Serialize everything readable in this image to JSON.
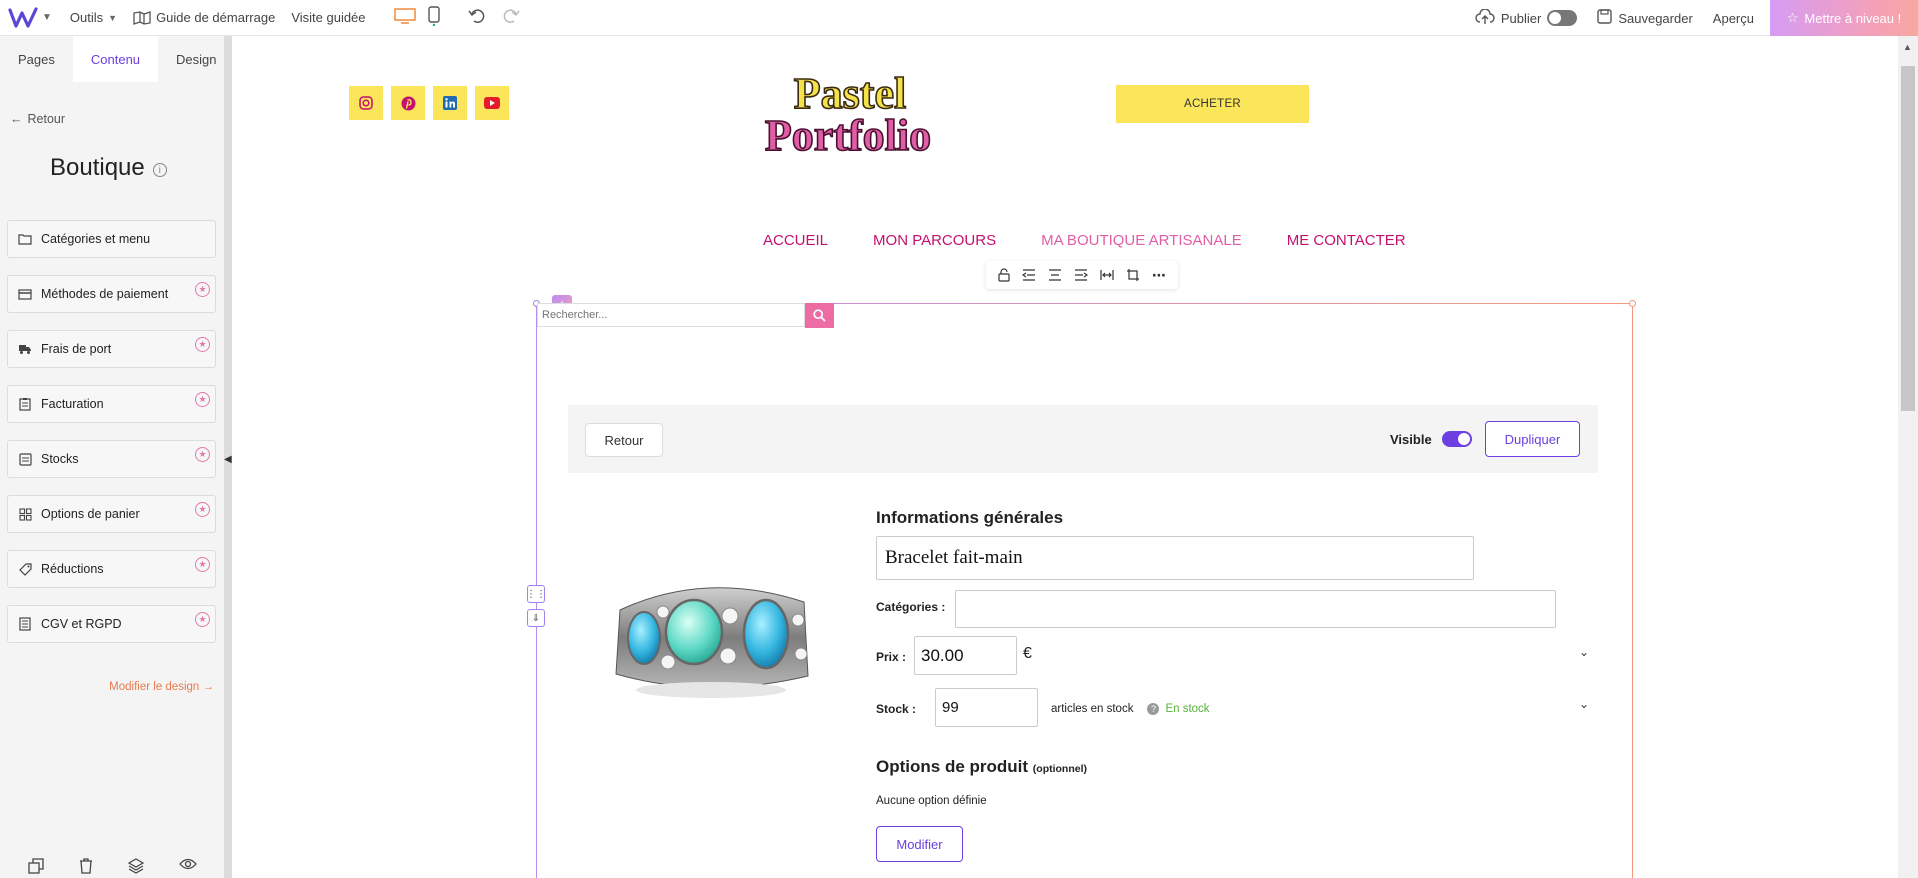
{
  "topbar": {
    "tools": "Outils",
    "start_guide": "Guide de démarrage",
    "guided_tour": "Visite guidée",
    "publish": "Publier",
    "save": "Sauvegarder",
    "preview": "Aperçu",
    "upgrade": "Mettre à niveau !"
  },
  "sidebar": {
    "tabs": [
      "Pages",
      "Contenu",
      "Design"
    ],
    "active_tab": "Contenu",
    "back": "Retour",
    "title": "Boutique",
    "items": [
      {
        "label": "Catégories et menu",
        "icon": "folder-icon",
        "premium": false
      },
      {
        "label": "Méthodes de paiement",
        "icon": "credit-card-icon",
        "premium": true
      },
      {
        "label": "Frais de port",
        "icon": "truck-icon",
        "premium": true
      },
      {
        "label": "Facturation",
        "icon": "clipboard-icon",
        "premium": true
      },
      {
        "label": "Stocks",
        "icon": "box-icon",
        "premium": true
      },
      {
        "label": "Options de panier",
        "icon": "grid-icon",
        "premium": true
      },
      {
        "label": "Réductions",
        "icon": "tag-icon",
        "premium": true
      },
      {
        "label": "CGV et RGPD",
        "icon": "document-icon",
        "premium": true
      }
    ],
    "modify_design": "Modifier le design →"
  },
  "site": {
    "socials": [
      "instagram-icon",
      "pinterest-icon",
      "linkedin-icon",
      "youtube-icon"
    ],
    "brand_line1": "Pastel",
    "brand_line2": "Portfolio",
    "buy": "ACHETER",
    "nav": [
      "ACCUEIL",
      "MON PARCOURS",
      "MA BOUTIQUE ARTISANALE",
      "ME CONTACTER"
    ],
    "search_placeholder": "Rechercher..."
  },
  "product_editor": {
    "back": "Retour",
    "visible": "Visible",
    "duplicate": "Dupliquer",
    "general_info": "Informations générales",
    "name": "Bracelet fait-main",
    "categories_label": "Catégories :",
    "price_label": "Prix :",
    "price": "30.00",
    "currency": "€",
    "stock_label": "Stock :",
    "stock": "99",
    "stock_unit": "articles en stock",
    "stock_status": "En stock",
    "options_title": "Options de produit",
    "options_optional": "(optionnel)",
    "no_options": "Aucune option définie",
    "modify": "Modifier"
  },
  "colors": {
    "accent": "#6b3fe0",
    "brand_pink": "#c4106e",
    "yellow": "#fbe55a",
    "stock_green": "#55b43a"
  }
}
